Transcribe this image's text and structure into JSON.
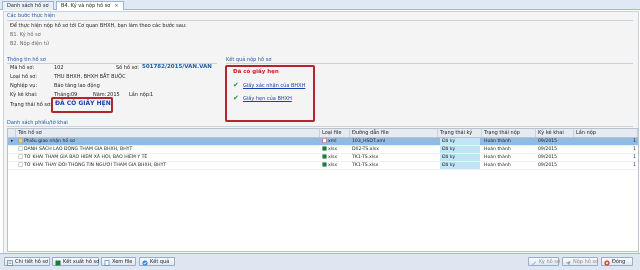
{
  "tabs": [
    {
      "label": "Danh sách hồ sơ",
      "active": false
    },
    {
      "label": "B4. Ký và nộp hồ sơ",
      "active": true
    }
  ],
  "steps": {
    "title": "Các bước thực hiện",
    "intro": "Để thực hiện nộp hồ sơ tới Cơ quan BHXH, bạn làm theo các bước sau:",
    "step1": "B1. Ký hồ sơ",
    "step2": "B2. Nộp điện tử"
  },
  "info": {
    "title": "Thông tin hồ sơ",
    "ma_ho_so_label": "Mã hồ sơ:",
    "ma_ho_so_value": "102",
    "so_ho_so_label": "Số hồ sơ:",
    "so_ho_so_value": "501782/2015/VAN.VAN",
    "loai_label": "Loại hồ sơ:",
    "loai_value": "THU BHXH, BHXH BẮT BUỘC",
    "nghiep_vu_label": "Nghiệp vụ:",
    "nghiep_vu_value": "Báo tăng lao động",
    "ky_ke_khai_label": "Kỳ kê khai:",
    "thang_label": "Tháng:",
    "thang_value": "09",
    "nam_label": "Năm:",
    "nam_value": "2015",
    "lan_nop_label": "Lần nộp:",
    "lan_nop_value": "1",
    "trang_thai_label": "Trạng thái hồ sơ:",
    "trang_thai_value": "ĐÃ CÓ GIẤY HẸN"
  },
  "result": {
    "title": "Kết quả nộp hồ sơ",
    "status": "Đã có giấy hẹn",
    "link1": "Giấy xác nhận của BHXH",
    "link2": "Giấy hẹn của BHXH"
  },
  "list": {
    "title": "Danh sách phiếu/tờ khai",
    "columns": [
      "Tên hồ sơ",
      "Loại file",
      "Đường dẫn file",
      "Trạng thái ký",
      "Trạng thái nộp",
      "Kỳ kê khai",
      "Lần nộp"
    ],
    "rows": [
      {
        "name": "Phiếu giao nhận hồ sơ",
        "type": "xml",
        "path": "103_HSDT.xml",
        "sign": "Đã ký",
        "submit": "Hoàn thành",
        "period": "09/2015",
        "times": "1",
        "selected": true
      },
      {
        "name": "DANH SÁCH LAO ĐỘNG THAM GIA BHXH, BHYT",
        "type": "xlsx",
        "path": "D02-TS.xlsx",
        "sign": "Đã ký",
        "submit": "Hoàn thành",
        "period": "09/2015",
        "times": "1",
        "selected": false
      },
      {
        "name": "TỜ KHAI THAM GIA BẢO HIỂM XÃ HỘI, BẢO HIỂM Y TẾ",
        "type": "xlsx",
        "path": "TK1-TS.xlsx",
        "sign": "Đã ký",
        "submit": "Hoàn thành",
        "period": "09/2015",
        "times": "1",
        "selected": false
      },
      {
        "name": "TỜ KHAI THAY ĐỔI THÔNG TIN NGƯỜI THAM GIA BHXH, BHYT",
        "type": "xlsx",
        "path": "TK1-TS.xlsx",
        "sign": "Đã ký",
        "submit": "Hoàn thành",
        "period": "09/2015",
        "times": "1",
        "selected": false
      }
    ]
  },
  "buttons": {
    "detail": "Chi tiết hồ sơ",
    "export": "Kết xuất hồ sơ",
    "view_file": "Xem file",
    "result": "Kết quả",
    "sign": "Ký hồ sơ",
    "submit": "Nộp hồ sơ",
    "close": "Đóng"
  },
  "colors": {
    "accent": "#1c5aa6",
    "alert": "#b3262b",
    "selected_row": "#8fbbe4"
  }
}
